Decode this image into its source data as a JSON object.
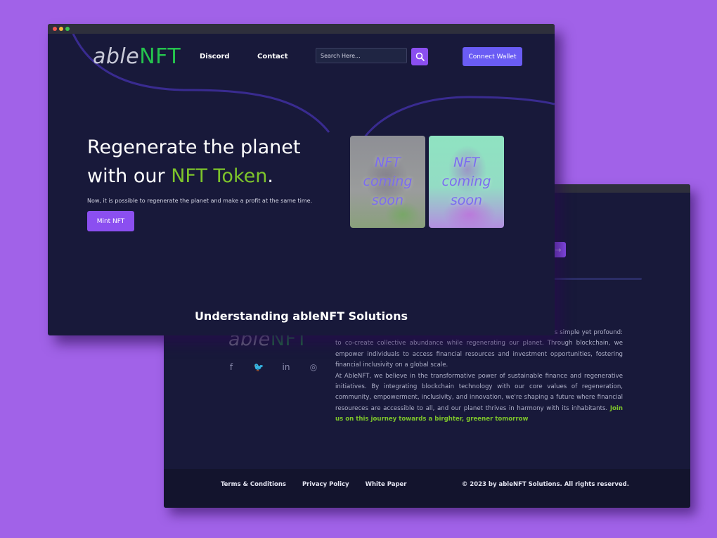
{
  "colors": {
    "background": "#a162e8",
    "window_bg": "#18193a",
    "accent_purple": "#8b4ff0",
    "accent_green": "#7dc42b",
    "connect_blue": "#6a5cf4",
    "logo_green": "#25c24d"
  },
  "front": {
    "logo": {
      "part1": "able",
      "part2": "NFT"
    },
    "nav": {
      "discord": "Discord",
      "contact": "Contact"
    },
    "search": {
      "placeholder": "Search Here...",
      "icon": "search-icon"
    },
    "connect_label": "Connect Wallet",
    "hero": {
      "line1": "Regenerate the planet",
      "line2_prefix": "with our ",
      "line2_accent": "NFT Token",
      "line2_suffix": ".",
      "subtitle": "Now, it is possible to regenerate the planet and make a profit at the same time.",
      "mint_label": "Mint NFT"
    },
    "nft_cards": [
      {
        "text": "NFT\ncoming\nsoon"
      },
      {
        "text": "NFT\ncoming\nsoon"
      }
    ],
    "section_heading": "Understanding ableNFT Solutions"
  },
  "back": {
    "logo": {
      "part1": "able",
      "part2": "NFT"
    },
    "socials": [
      {
        "icon": "facebook-icon",
        "glyph": "f"
      },
      {
        "icon": "twitter-icon",
        "glyph": "🐦"
      },
      {
        "icon": "linkedin-icon",
        "glyph": "in"
      },
      {
        "icon": "instagram-icon",
        "glyph": "◎"
      }
    ],
    "about": {
      "p1": "eering a revolutionary approach to blockchain technology. Our mission is simple yet profound: to co-create collective abundance while regenerating our planet. Through blockchain, we empower individuals to access financial resources and investment opportunities, fostering financial inclusivity on a global scale.",
      "p2": "At AbleNFT, we believe in the transformative power of sustainable finance and regenerative initiatives. By integrating blockchain technology with our core values of regeneration, community, empowerment, inclusivity, and innovation, we're shaping a future where financial resoureces are accessible to all, and our planet thrives in harmony with its inhabitants.",
      "highlight": "Join us on this journey towards a birghter, greener tomorrow"
    },
    "footer": {
      "links": [
        "Terms & Conditions",
        "Privacy Policy",
        "White Paper"
      ],
      "copyright": "© 2023 by ableNFT Solutions. All rights reserved."
    }
  }
}
